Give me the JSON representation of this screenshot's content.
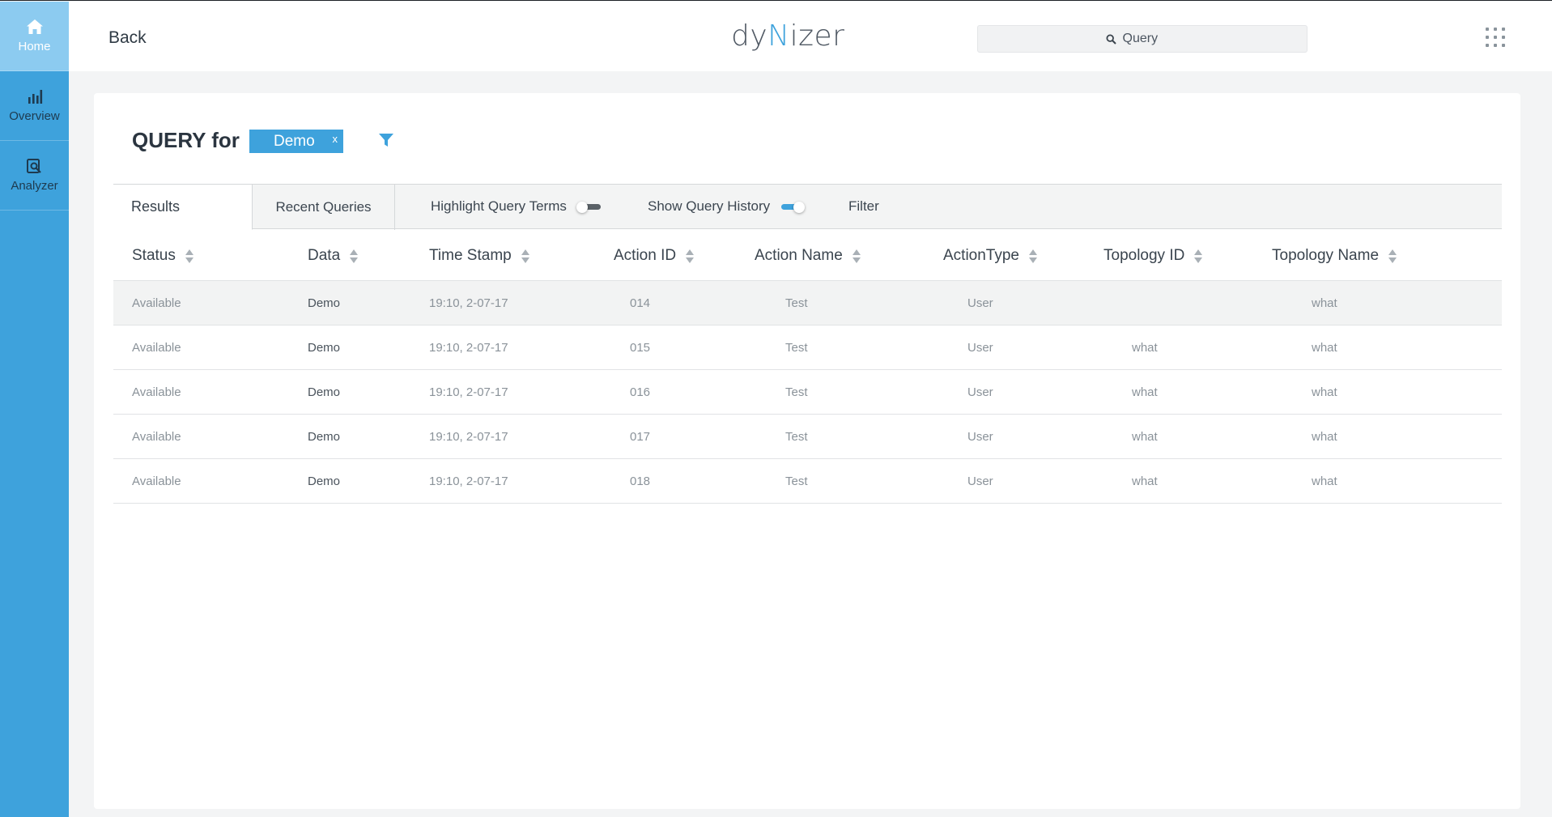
{
  "sidebar": {
    "items": [
      {
        "label": "Home",
        "icon": "home-icon",
        "active": true
      },
      {
        "label": "Overview",
        "icon": "bar-chart-icon",
        "active": false
      },
      {
        "label": "Analyzer",
        "icon": "analyzer-icon",
        "active": false
      }
    ]
  },
  "header": {
    "back_label": "Back",
    "logo_parts": [
      "dy",
      "N",
      "izer"
    ],
    "search_placeholder": "Query"
  },
  "query": {
    "title": "QUERY for",
    "chip_label": "Demo",
    "chip_close": "x"
  },
  "tabs": {
    "results": "Results",
    "recent": "Recent Queries",
    "highlight_label": "Highlight Query Terms",
    "highlight_on": false,
    "history_label": "Show Query History",
    "history_on": true,
    "filter_label": "Filter"
  },
  "table": {
    "columns": [
      "Status",
      "Data",
      "Time Stamp",
      "Action ID",
      "Action Name",
      "ActionType",
      "Topology ID",
      "Topology Name"
    ],
    "rows": [
      {
        "status": "Available",
        "data": "Demo",
        "timestamp": "19:10, 2-07-17",
        "action_id": "014",
        "action_name": "Test",
        "action_type": "User",
        "topology_id": "",
        "topology_name": "what"
      },
      {
        "status": "Available",
        "data": "Demo",
        "timestamp": "19:10, 2-07-17",
        "action_id": "015",
        "action_name": "Test",
        "action_type": "User",
        "topology_id": "what",
        "topology_name": "what"
      },
      {
        "status": "Available",
        "data": "Demo",
        "timestamp": "19:10, 2-07-17",
        "action_id": "016",
        "action_name": "Test",
        "action_type": "User",
        "topology_id": "what",
        "topology_name": "what"
      },
      {
        "status": "Available",
        "data": "Demo",
        "timestamp": "19:10, 2-07-17",
        "action_id": "017",
        "action_name": "Test",
        "action_type": "User",
        "topology_id": "what",
        "topology_name": "what"
      },
      {
        "status": "Available",
        "data": "Demo",
        "timestamp": "19:10, 2-07-17",
        "action_id": "018",
        "action_name": "Test",
        "action_type": "User",
        "topology_id": "what",
        "topology_name": "what"
      }
    ]
  },
  "colors": {
    "accent": "#3ea2dc",
    "sidebar_active": "#8ccbf0"
  }
}
